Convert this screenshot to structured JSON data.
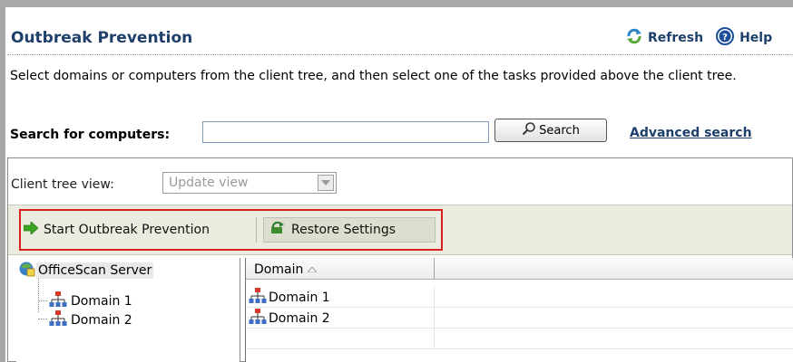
{
  "page": {
    "title": "Outbreak Prevention",
    "refresh_label": "Refresh",
    "help_label": "Help",
    "description": "Select domains or computers from the client tree, and then select one of the tasks provided above the client tree."
  },
  "search": {
    "label": "Search for computers:",
    "value": "",
    "button_label": "Search",
    "advanced_label": "Advanced search"
  },
  "client_tree_view": {
    "label": "Client tree view:",
    "selected": "Update view"
  },
  "toolbar": {
    "start_label": "Start Outbreak Prevention",
    "restore_label": "Restore Settings"
  },
  "tree": {
    "root": "OfficeScan Server",
    "children": [
      "Domain 1",
      "Domain 2"
    ]
  },
  "grid": {
    "column_header": "Domain",
    "rows": [
      "Domain 1",
      "Domain 2"
    ]
  }
}
